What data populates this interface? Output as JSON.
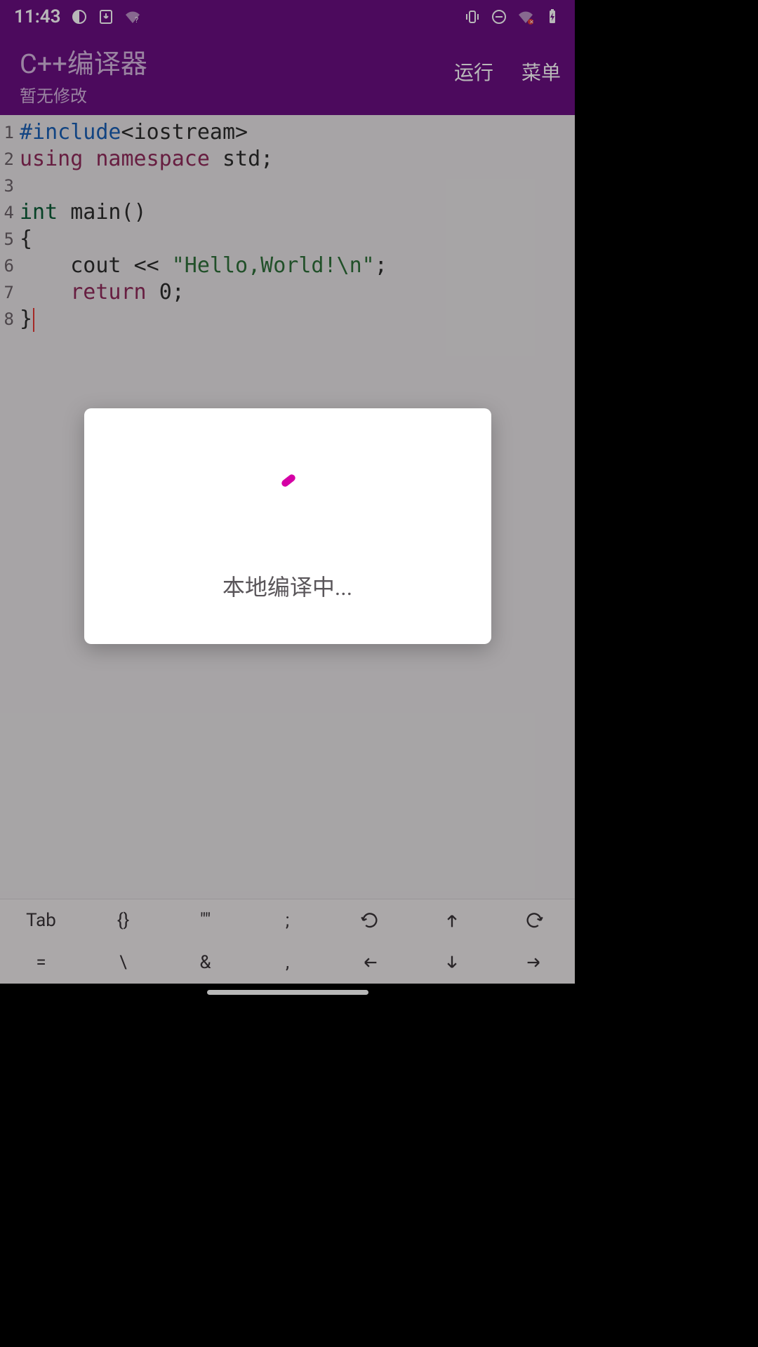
{
  "statusbar": {
    "time": "11:43"
  },
  "appbar": {
    "title": "C++编译器",
    "subtitle": "暂无修改",
    "actions": {
      "run": "运行",
      "menu": "菜单"
    }
  },
  "code": {
    "lines": [
      {
        "n": 1,
        "tokens": [
          {
            "cls": "tok-preproc",
            "t": "#include"
          },
          {
            "cls": "tok-angle",
            "t": "<iostream>"
          }
        ]
      },
      {
        "n": 2,
        "tokens": [
          {
            "cls": "tok-kw",
            "t": "using "
          },
          {
            "cls": "tok-kw",
            "t": "namespace "
          },
          {
            "cls": "tok-ident",
            "t": "std"
          },
          {
            "cls": "tok-punc",
            "t": ";"
          }
        ]
      },
      {
        "n": 3,
        "tokens": []
      },
      {
        "n": 4,
        "tokens": [
          {
            "cls": "tok-type",
            "t": "int "
          },
          {
            "cls": "tok-ident",
            "t": "main()"
          }
        ]
      },
      {
        "n": 5,
        "tokens": [
          {
            "cls": "tok-punc",
            "t": "{"
          }
        ]
      },
      {
        "n": 6,
        "tokens": [
          {
            "cls": "tok-ident",
            "t": "    cout "
          },
          {
            "cls": "tok-op",
            "t": "<< "
          },
          {
            "cls": "tok-str",
            "t": "\"Hello,World!\\n\""
          },
          {
            "cls": "tok-punc",
            "t": ";"
          }
        ]
      },
      {
        "n": 7,
        "tokens": [
          {
            "cls": "tok-ret",
            "t": "    return "
          },
          {
            "cls": "tok-ident",
            "t": "0"
          },
          {
            "cls": "tok-punc",
            "t": ";"
          }
        ]
      },
      {
        "n": 8,
        "tokens": [
          {
            "cls": "tok-punc",
            "t": "}"
          }
        ],
        "cursorAfter": true
      }
    ]
  },
  "dialog": {
    "text": "本地编译中..."
  },
  "toolbar": {
    "row1": [
      "Tab",
      "{}",
      "\"\"",
      ";",
      "undo",
      "up",
      "redo"
    ],
    "row2": [
      "=",
      "\\",
      "&",
      ",",
      "left",
      "down",
      "right"
    ]
  }
}
